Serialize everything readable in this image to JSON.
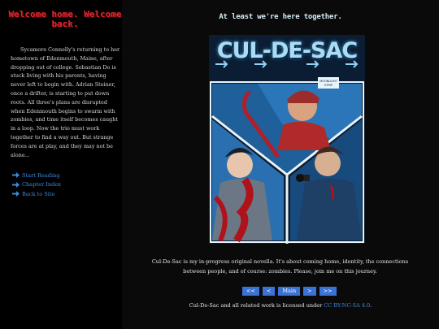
{
  "sidebar": {
    "title": "Welcome home. Welcome back.",
    "synopsis": "Sycamore Connelly's returning to her hometown of Edenmouth, Maine, after dropping out of college. Sebastian Do is stuck living with his parents, having never left to begin with. Adrian Steiner, once a drifter, is starting to put down roots. All three's plans are disrupted when Edenmouth begins to swarm with zombies, and time itself becomes caught in a loop. Now the trio must work together to find a way out. But strange forces are at play, and they may not be alone...",
    "nav": [
      {
        "label": "Start Reading",
        "icon": "arrow-right-icon"
      },
      {
        "label": "Chapter Index",
        "icon": "arrow-right-icon"
      },
      {
        "label": "Back to Site",
        "icon": "arrow-right-icon"
      }
    ]
  },
  "main": {
    "tagline": "At least we're here together.",
    "cover": {
      "title": "CUL-DE-SAC",
      "sign_text": "MOONLIGHT\nSTRIP"
    },
    "description": "Cul-De-Sac is my in-progress original novella. It's about coming home, identity, the connections between people, and of course: zombies. Please, join me on this journey.",
    "pager": {
      "first": "<<",
      "prev": "<",
      "main": "Main",
      "next": ">",
      "last": ">>"
    },
    "license": {
      "prefix": "Cul-De-Sac and all related work is licensed under ",
      "link": "CC BY-NC-SA 4.0",
      "suffix": "."
    }
  },
  "colors": {
    "title_red": "#e0262d",
    "link_blue": "#3b8be0",
    "button_blue": "#3a72d6",
    "background": "#0a0a0a"
  }
}
